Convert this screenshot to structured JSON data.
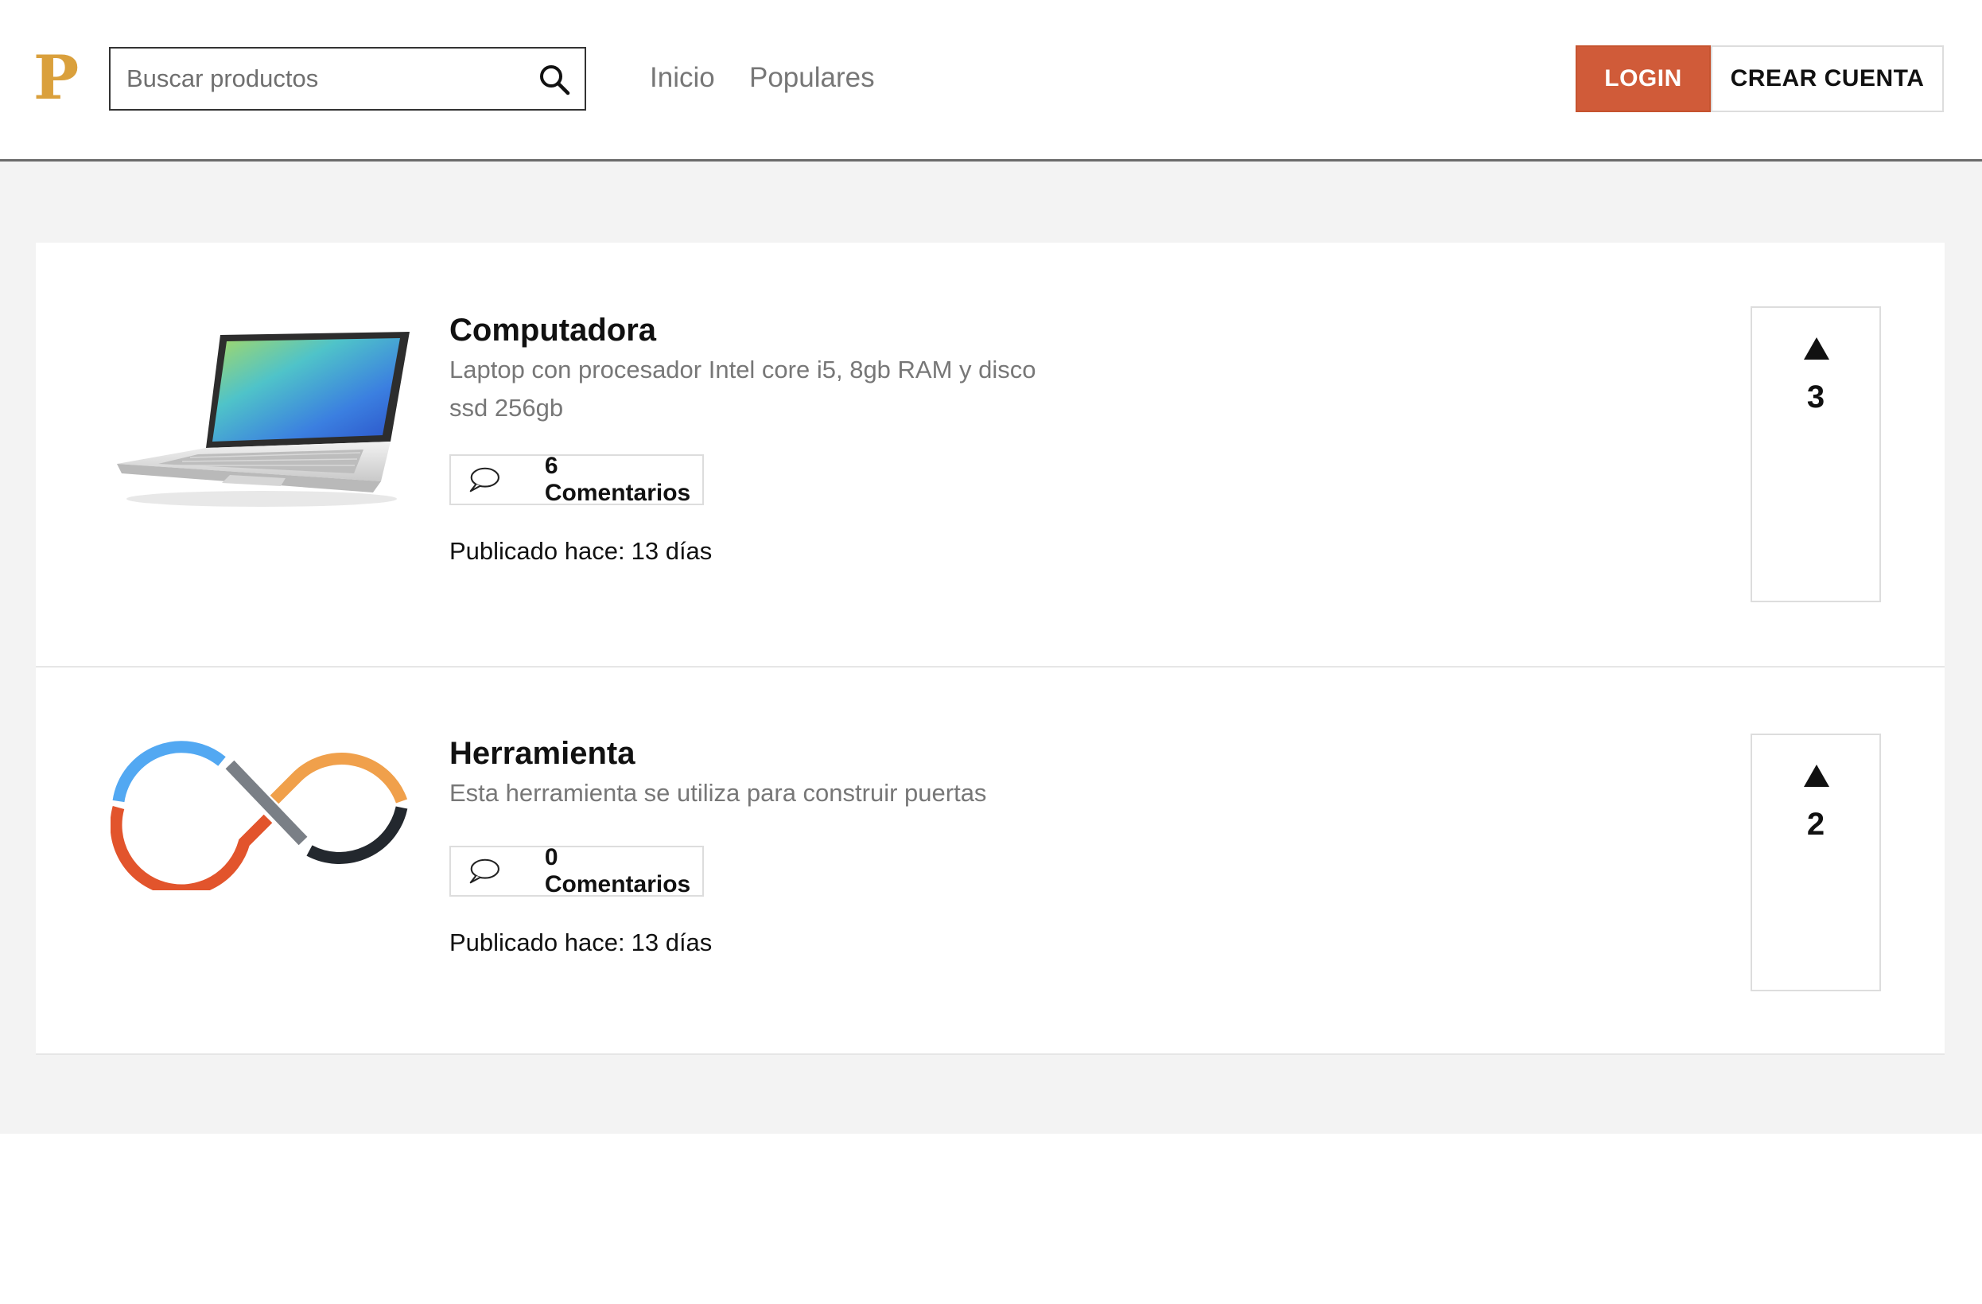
{
  "brand": {
    "logo_letter": "P",
    "logo_color": "#daa03c"
  },
  "search": {
    "placeholder": "Buscar productos",
    "value": "",
    "icon": "search-icon"
  },
  "nav": {
    "items": [
      {
        "label": "Inicio"
      },
      {
        "label": "Populares"
      }
    ]
  },
  "auth": {
    "login_label": "LOGIN",
    "signup_label": "CREAR CUENTA",
    "login_color": "#d05b39"
  },
  "products": [
    {
      "title": "Computadora",
      "description": "Laptop con procesador Intel core i5, 8gb RAM y disco ssd 256gb",
      "image": "laptop-image",
      "comments_label": "6 Comentarios",
      "published_label": "Publicado hace:",
      "published_value": "13 días",
      "votes": "3"
    },
    {
      "title": "Herramienta",
      "description": "Esta herramienta se utiliza para construir puertas",
      "image": "infinity-logo-image",
      "comments_label": "0 Comentarios",
      "published_label": "Publicado hace:",
      "published_value": "13 días",
      "votes": "2"
    }
  ],
  "colors": {
    "background": "#f3f3f3",
    "card": "#ffffff",
    "text_muted": "#777777",
    "infinity_blue": "#52a8f2",
    "infinity_orange": "#f0a04b",
    "infinity_red": "#e2542c",
    "infinity_gray": "#7a7f86",
    "infinity_dark": "#23282e"
  }
}
